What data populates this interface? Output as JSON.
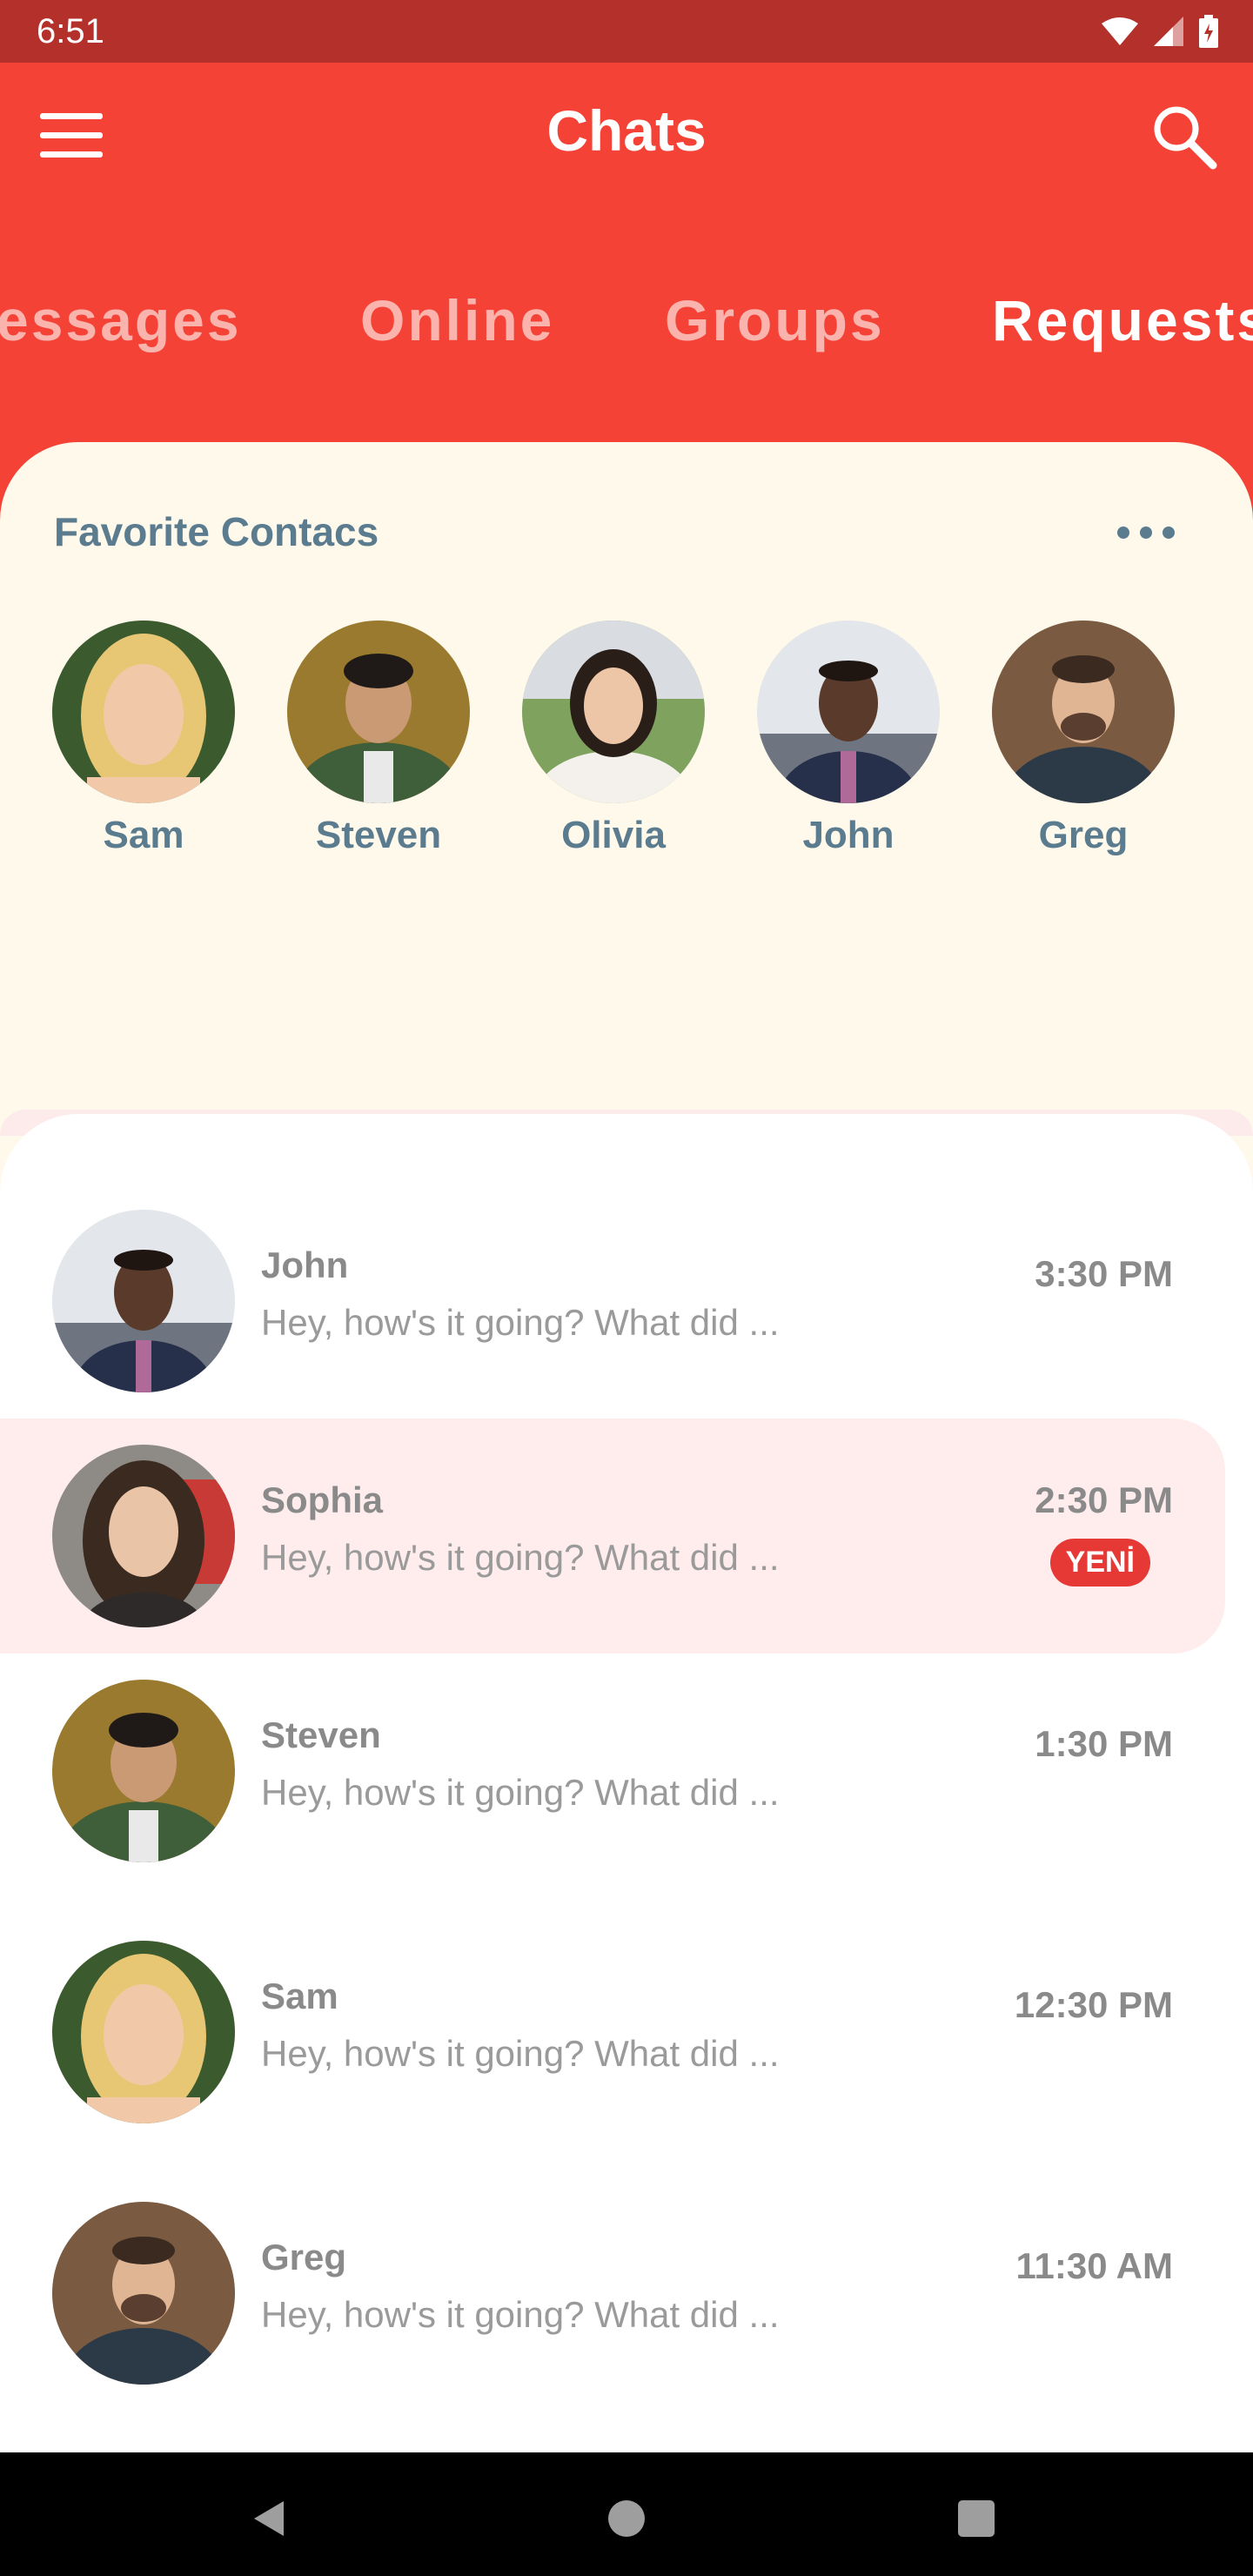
{
  "status": {
    "time": "6:51"
  },
  "header": {
    "title": "Chats"
  },
  "tabs": [
    "essages",
    "Online",
    "Groups",
    "Requests"
  ],
  "favorites": {
    "title": "Favorite Contacs",
    "contacts": [
      {
        "name": "Sam"
      },
      {
        "name": "Steven"
      },
      {
        "name": "Olivia"
      },
      {
        "name": "John"
      },
      {
        "name": "Greg"
      }
    ]
  },
  "chats": [
    {
      "name": "John",
      "message": "Hey, how's it going? What did ...",
      "time": "3:30 PM",
      "unread": false
    },
    {
      "name": "Sophia",
      "message": "Hey, how's it going? What did ...",
      "time": "2:30 PM",
      "unread": true,
      "badge": "YENİ"
    },
    {
      "name": "Steven",
      "message": "Hey, how's it going? What did ...",
      "time": "1:30 PM",
      "unread": false
    },
    {
      "name": "Sam",
      "message": "Hey, how's it going? What did ...",
      "time": "12:30 PM",
      "unread": false
    },
    {
      "name": "Greg",
      "message": "Hey, how's it going? What did ...",
      "time": "11:30 AM",
      "unread": false
    }
  ],
  "icons": {
    "menu": "menu-icon",
    "search": "search-icon",
    "more": "more-horizontal-icon",
    "back": "back-triangle-icon",
    "home": "home-circle-icon",
    "recents": "recents-square-icon"
  },
  "colors": {
    "primary": "#F44336",
    "status_bar": "#B3302B",
    "favorites_bg": "#FEF9EB",
    "unread_bg": "#FFEDEE",
    "badge": "#E63935",
    "contact_name": "#5B7B8F"
  }
}
